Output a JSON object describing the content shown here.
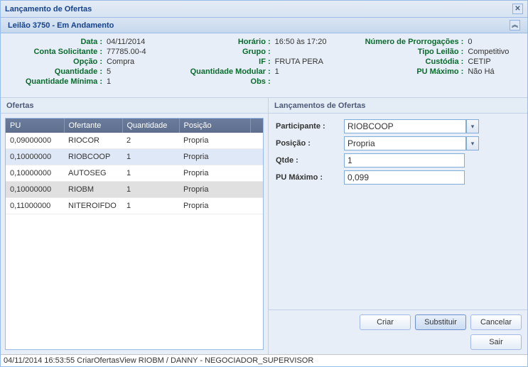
{
  "window": {
    "title": "Lançamento de Ofertas"
  },
  "subtitle": "Leilão 3750 - Em Andamento",
  "info": {
    "data_label": "Data :",
    "data_value": "04/11/2014",
    "conta_label": "Conta Solicitante :",
    "conta_value": "77785.00-4",
    "opcao_label": "Opção :",
    "opcao_value": "Compra",
    "qtd_label": "Quantidade :",
    "qtd_value": "5",
    "qtdmin_label": "Quantidade Mínima :",
    "qtdmin_value": "1",
    "horario_label": "Horário :",
    "horario_value": "16:50 às 17:20",
    "grupo_label": "Grupo :",
    "grupo_value": "",
    "if_label": "IF :",
    "if_value": "FRUTA PERA",
    "qtdmod_label": "Quantidade Modular :",
    "qtdmod_value": "1",
    "obs_label": "Obs :",
    "obs_value": "",
    "prorrog_label": "Número de Prorrogações :",
    "prorrog_value": "0",
    "tipo_label": "Tipo Leilão :",
    "tipo_value": "Competitivo",
    "custodia_label": "Custódia :",
    "custodia_value": "CETIP",
    "pumax_label": "PU Máximo :",
    "pumax_value": "Não Há"
  },
  "ofertas": {
    "title": "Ofertas",
    "columns": {
      "pu": "PU",
      "ofertante": "Ofertante",
      "quantidade": "Quantidade",
      "posicao": "Posição"
    },
    "rows": [
      {
        "pu": "0,09000000",
        "ofertante": "RIOCOR",
        "quantidade": "2",
        "posicao": "Propria",
        "state": ""
      },
      {
        "pu": "0,10000000",
        "ofertante": "RIOBCOOP",
        "quantidade": "1",
        "posicao": "Propria",
        "state": "sel"
      },
      {
        "pu": "0,10000000",
        "ofertante": "AUTOSEG",
        "quantidade": "1",
        "posicao": "Propria",
        "state": ""
      },
      {
        "pu": "0,10000000",
        "ofertante": "RIOBM",
        "quantidade": "1",
        "posicao": "Propria",
        "state": "hover"
      },
      {
        "pu": "0,11000000",
        "ofertante": "NITEROIFDO",
        "quantidade": "1",
        "posicao": "Propria",
        "state": ""
      }
    ]
  },
  "lanc": {
    "title": "Lançamentos de Ofertas",
    "participante_label": "Participante :",
    "participante_value": "RIOBCOOP",
    "posicao_label": "Posição :",
    "posicao_value": "Propria",
    "qtde_label": "Qtde :",
    "qtde_value": "1",
    "pumax_label": "PU Máximo :",
    "pumax_value": "0,099"
  },
  "buttons": {
    "criar": "Criar",
    "substituir": "Substituir",
    "cancelar": "Cancelar",
    "sair": "Sair"
  },
  "status": "04/11/2014 16:53:55 CriarOfertasView RIOBM / DANNY - NEGOCIADOR_SUPERVISOR"
}
